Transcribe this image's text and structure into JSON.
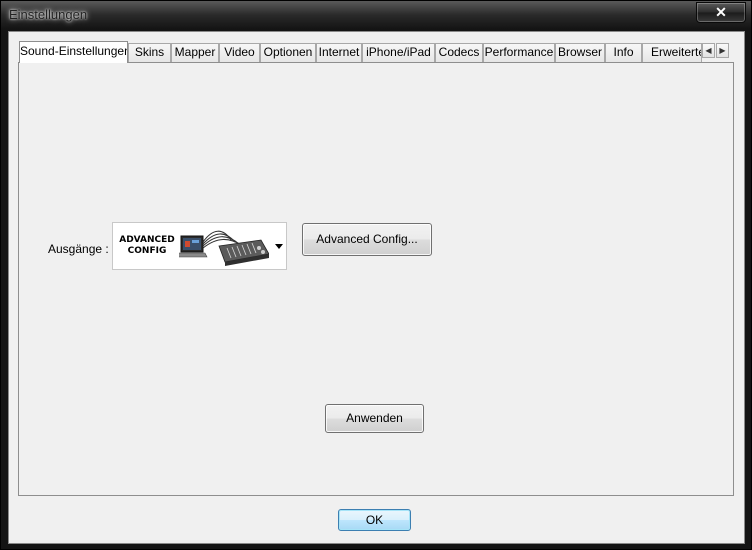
{
  "window": {
    "title": "Einstellungen",
    "close_label": "✕"
  },
  "tabs": [
    {
      "label": "Sound-Einstellungen",
      "active": true
    },
    {
      "label": "Skins"
    },
    {
      "label": "Mapper"
    },
    {
      "label": "Video"
    },
    {
      "label": "Optionen"
    },
    {
      "label": "Internet"
    },
    {
      "label": "iPhone/iPad"
    },
    {
      "label": "Codecs"
    },
    {
      "label": "Performance"
    },
    {
      "label": "Browser"
    },
    {
      "label": "Info"
    },
    {
      "label": "Erweiterte"
    }
  ],
  "tab_scroll": {
    "left_icon": "◀",
    "right_icon": "▶"
  },
  "sound": {
    "outputs_label": "Ausgänge :",
    "outputs_selected_line1": "ADVANCED",
    "outputs_selected_line2": "CONFIG",
    "advanced_config_button": "Advanced Config...",
    "apply_button": "Anwenden"
  },
  "footer": {
    "ok_button": "OK"
  },
  "icons": {
    "dropdown": "chevron-down-icon",
    "mixer": "laptop-mixer-image"
  }
}
